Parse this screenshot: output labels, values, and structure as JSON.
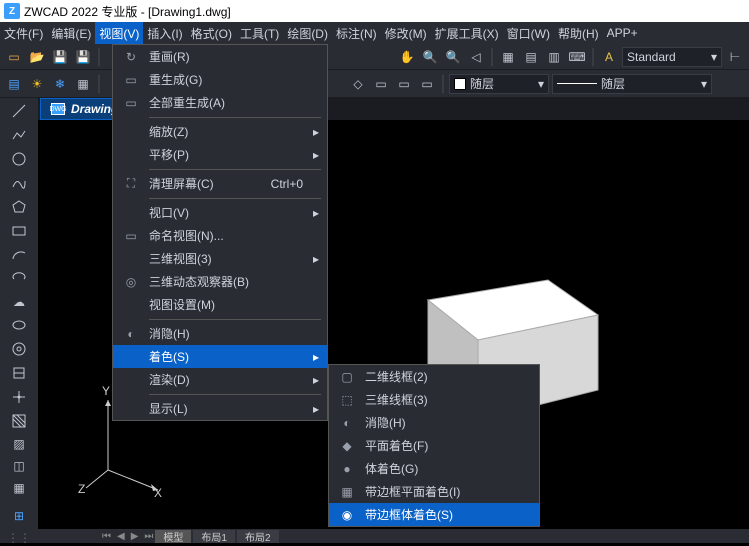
{
  "title": "ZWCAD 2022 专业版 - [Drawing1.dwg]",
  "menubar": {
    "file": "文件(F)",
    "edit": "编辑(E)",
    "view": "视图(V)",
    "insert": "插入(I)",
    "format": "格式(O)",
    "tools": "工具(T)",
    "draw": "绘图(D)",
    "dimension": "标注(N)",
    "modify": "修改(M)",
    "extend": "扩展工具(X)",
    "window": "窗口(W)",
    "help": "帮助(H)",
    "app": "APP+"
  },
  "styleCombo": "Standard",
  "layerCombo": "随层",
  "linetypeCombo": "随层",
  "doctab": "Drawing1.dwg",
  "dropdown": {
    "redraw": "重画(R)",
    "regen": "重生成(G)",
    "regenAll": "全部重生成(A)",
    "zoom": "缩放(Z)",
    "pan": "平移(P)",
    "cleanScreen": "清理屏幕(C)",
    "cleanScreenAccel": "Ctrl+0",
    "viewport": "视口(V)",
    "namedViews": "命名视图(N)...",
    "view3d": "三维视图(3)",
    "orbit3d": "三维动态观察器(B)",
    "viewSettings": "视图设置(M)",
    "hide": "消隐(H)",
    "shade": "着色(S)",
    "render": "渲染(D)",
    "display": "显示(L)"
  },
  "submenu": {
    "wire2d": "二维线框(2)",
    "wire3d": "三维线框(3)",
    "hidden": "消隐(H)",
    "flat": "平面着色(F)",
    "gouraud": "体着色(G)",
    "flatEdge": "带边框平面着色(I)",
    "gouraudEdge": "带边框体着色(S)"
  },
  "ucs": {
    "x": "X",
    "y": "Y",
    "z": "Z"
  },
  "bottomTabs": {
    "model": "模型",
    "layout1": "布局1",
    "layout2": "布局2"
  }
}
